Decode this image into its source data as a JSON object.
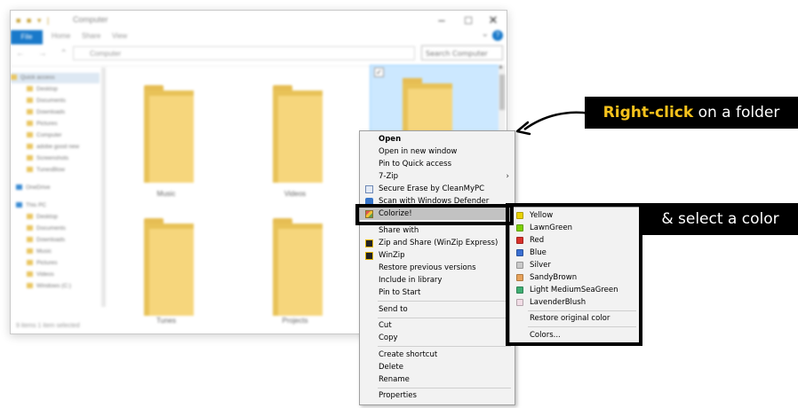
{
  "explorer": {
    "title": "Computer",
    "file_tab": "File",
    "ribbon_tabs": [
      "Home",
      "Share",
      "View"
    ],
    "address": "Computer",
    "search_placeholder": "Search Computer",
    "status": "9 items   1 item selected",
    "nav_items": [
      "Quick access",
      "Desktop",
      "Documents",
      "Downloads",
      "Pictures",
      "Computer",
      "adobe good new",
      "Screenshots",
      "TunesBlow",
      "OneDrive",
      "This PC",
      "Desktop",
      "Documents",
      "Downloads",
      "Music",
      "Pictures",
      "Videos",
      "Windows (C:)"
    ],
    "folders": [
      "Music",
      "Videos",
      "Tunes",
      "Projects"
    ]
  },
  "context_menu": {
    "items": [
      {
        "label": "Open",
        "bold": true
      },
      {
        "label": "Open in new window"
      },
      {
        "label": "Pin to Quick access"
      },
      {
        "label": "7-Zip",
        "submenu": true
      },
      {
        "label": "Secure Erase by CleanMyPC",
        "icon": "document-icon"
      },
      {
        "label": "Scan with Windows Defender",
        "icon": "shield-icon"
      },
      {
        "label": "Colorize!",
        "icon": "colorize-icon",
        "submenu": true,
        "highlighted": true
      },
      {
        "label": "Share with",
        "submenu": true
      },
      {
        "label": "Zip and Share (WinZip Express)",
        "icon": "winzip-icon"
      },
      {
        "label": "WinZip",
        "icon": "winzip-icon",
        "submenu": true
      },
      {
        "label": "Restore previous versions"
      },
      {
        "label": "Include in library",
        "submenu": true
      },
      {
        "label": "Pin to Start"
      },
      {
        "label": "Send to",
        "submenu": true
      },
      {
        "label": "Cut"
      },
      {
        "label": "Copy"
      },
      {
        "label": "Create shortcut"
      },
      {
        "label": "Delete"
      },
      {
        "label": "Rename"
      },
      {
        "label": "Properties"
      }
    ]
  },
  "colorize_submenu": {
    "colors": [
      {
        "label": "Yellow",
        "color": "#e8d200"
      },
      {
        "label": "LawnGreen",
        "color": "#7cd000"
      },
      {
        "label": "Red",
        "color": "#d8312a"
      },
      {
        "label": "Blue",
        "color": "#3a6fd1"
      },
      {
        "label": "Silver",
        "color": "#c9c9c9"
      },
      {
        "label": "SandyBrown",
        "color": "#e7a25a"
      },
      {
        "label": "Light MediumSeaGreen",
        "color": "#3fae72"
      },
      {
        "label": "LavenderBlush",
        "color": "#f1dde6"
      }
    ],
    "restore_label": "Restore original color",
    "colors_label": "Colors..."
  },
  "callouts": {
    "right_click_accent": "Right-click",
    "right_click_rest": " on a folder",
    "select_color": "& select a color"
  },
  "colors": {
    "accent_yellow": "#f5c21c",
    "selection_blue": "#cce8ff",
    "file_tab_blue": "#1979ca"
  }
}
